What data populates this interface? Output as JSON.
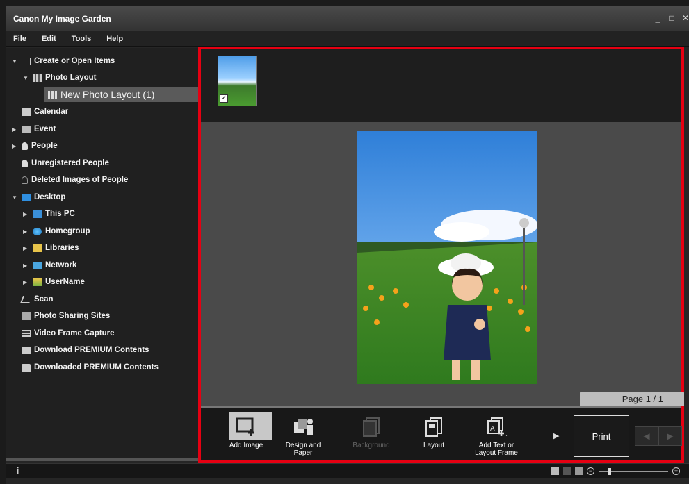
{
  "window": {
    "title": "Canon My Image Garden",
    "controls": {
      "minimize": "_",
      "maximize": "□",
      "close": "✕"
    }
  },
  "menu": {
    "items": [
      "File",
      "Edit",
      "Tools",
      "Help"
    ]
  },
  "sidebar": {
    "items": [
      {
        "label": "Create or Open Items",
        "icon": "create-icon"
      },
      {
        "label": "Photo Layout",
        "icon": "photo-layout-icon"
      },
      {
        "label": "New Photo Layout (1)",
        "icon": "photo-layout-icon"
      },
      {
        "label": "Calendar",
        "icon": "calendar-icon"
      },
      {
        "label": "Event",
        "icon": "event-icon"
      },
      {
        "label": "People",
        "icon": "person-icon"
      },
      {
        "label": "Unregistered People",
        "icon": "unregistered-person-icon"
      },
      {
        "label": "Deleted Images of People",
        "icon": "deleted-person-icon"
      },
      {
        "label": "Desktop",
        "icon": "desktop-icon"
      },
      {
        "label": "This PC",
        "icon": "pc-icon"
      },
      {
        "label": "Homegroup",
        "icon": "homegroup-icon"
      },
      {
        "label": "Libraries",
        "icon": "libraries-icon"
      },
      {
        "label": "Network",
        "icon": "network-icon"
      },
      {
        "label": "UserName",
        "icon": "user-folder-icon"
      },
      {
        "label": "Scan",
        "icon": "scan-icon"
      },
      {
        "label": "Photo Sharing Sites",
        "icon": "photo-sharing-icon"
      },
      {
        "label": "Video Frame Capture",
        "icon": "video-frame-icon"
      },
      {
        "label": "Download PREMIUM Contents",
        "icon": "download-icon"
      },
      {
        "label": "Downloaded PREMIUM Contents",
        "icon": "folder-icon"
      }
    ]
  },
  "page_indicator": "Page 1 / 1",
  "toolbar": {
    "add_image": "Add Image",
    "design_and_paper": "Design and Paper",
    "background": "Background",
    "layout": "Layout",
    "add_text": "Add Text or Layout Frame",
    "print": "Print"
  },
  "status": {
    "info": "i"
  },
  "colors": {
    "highlight_border": "#e60012",
    "selected_item": "#5a5a5a"
  }
}
